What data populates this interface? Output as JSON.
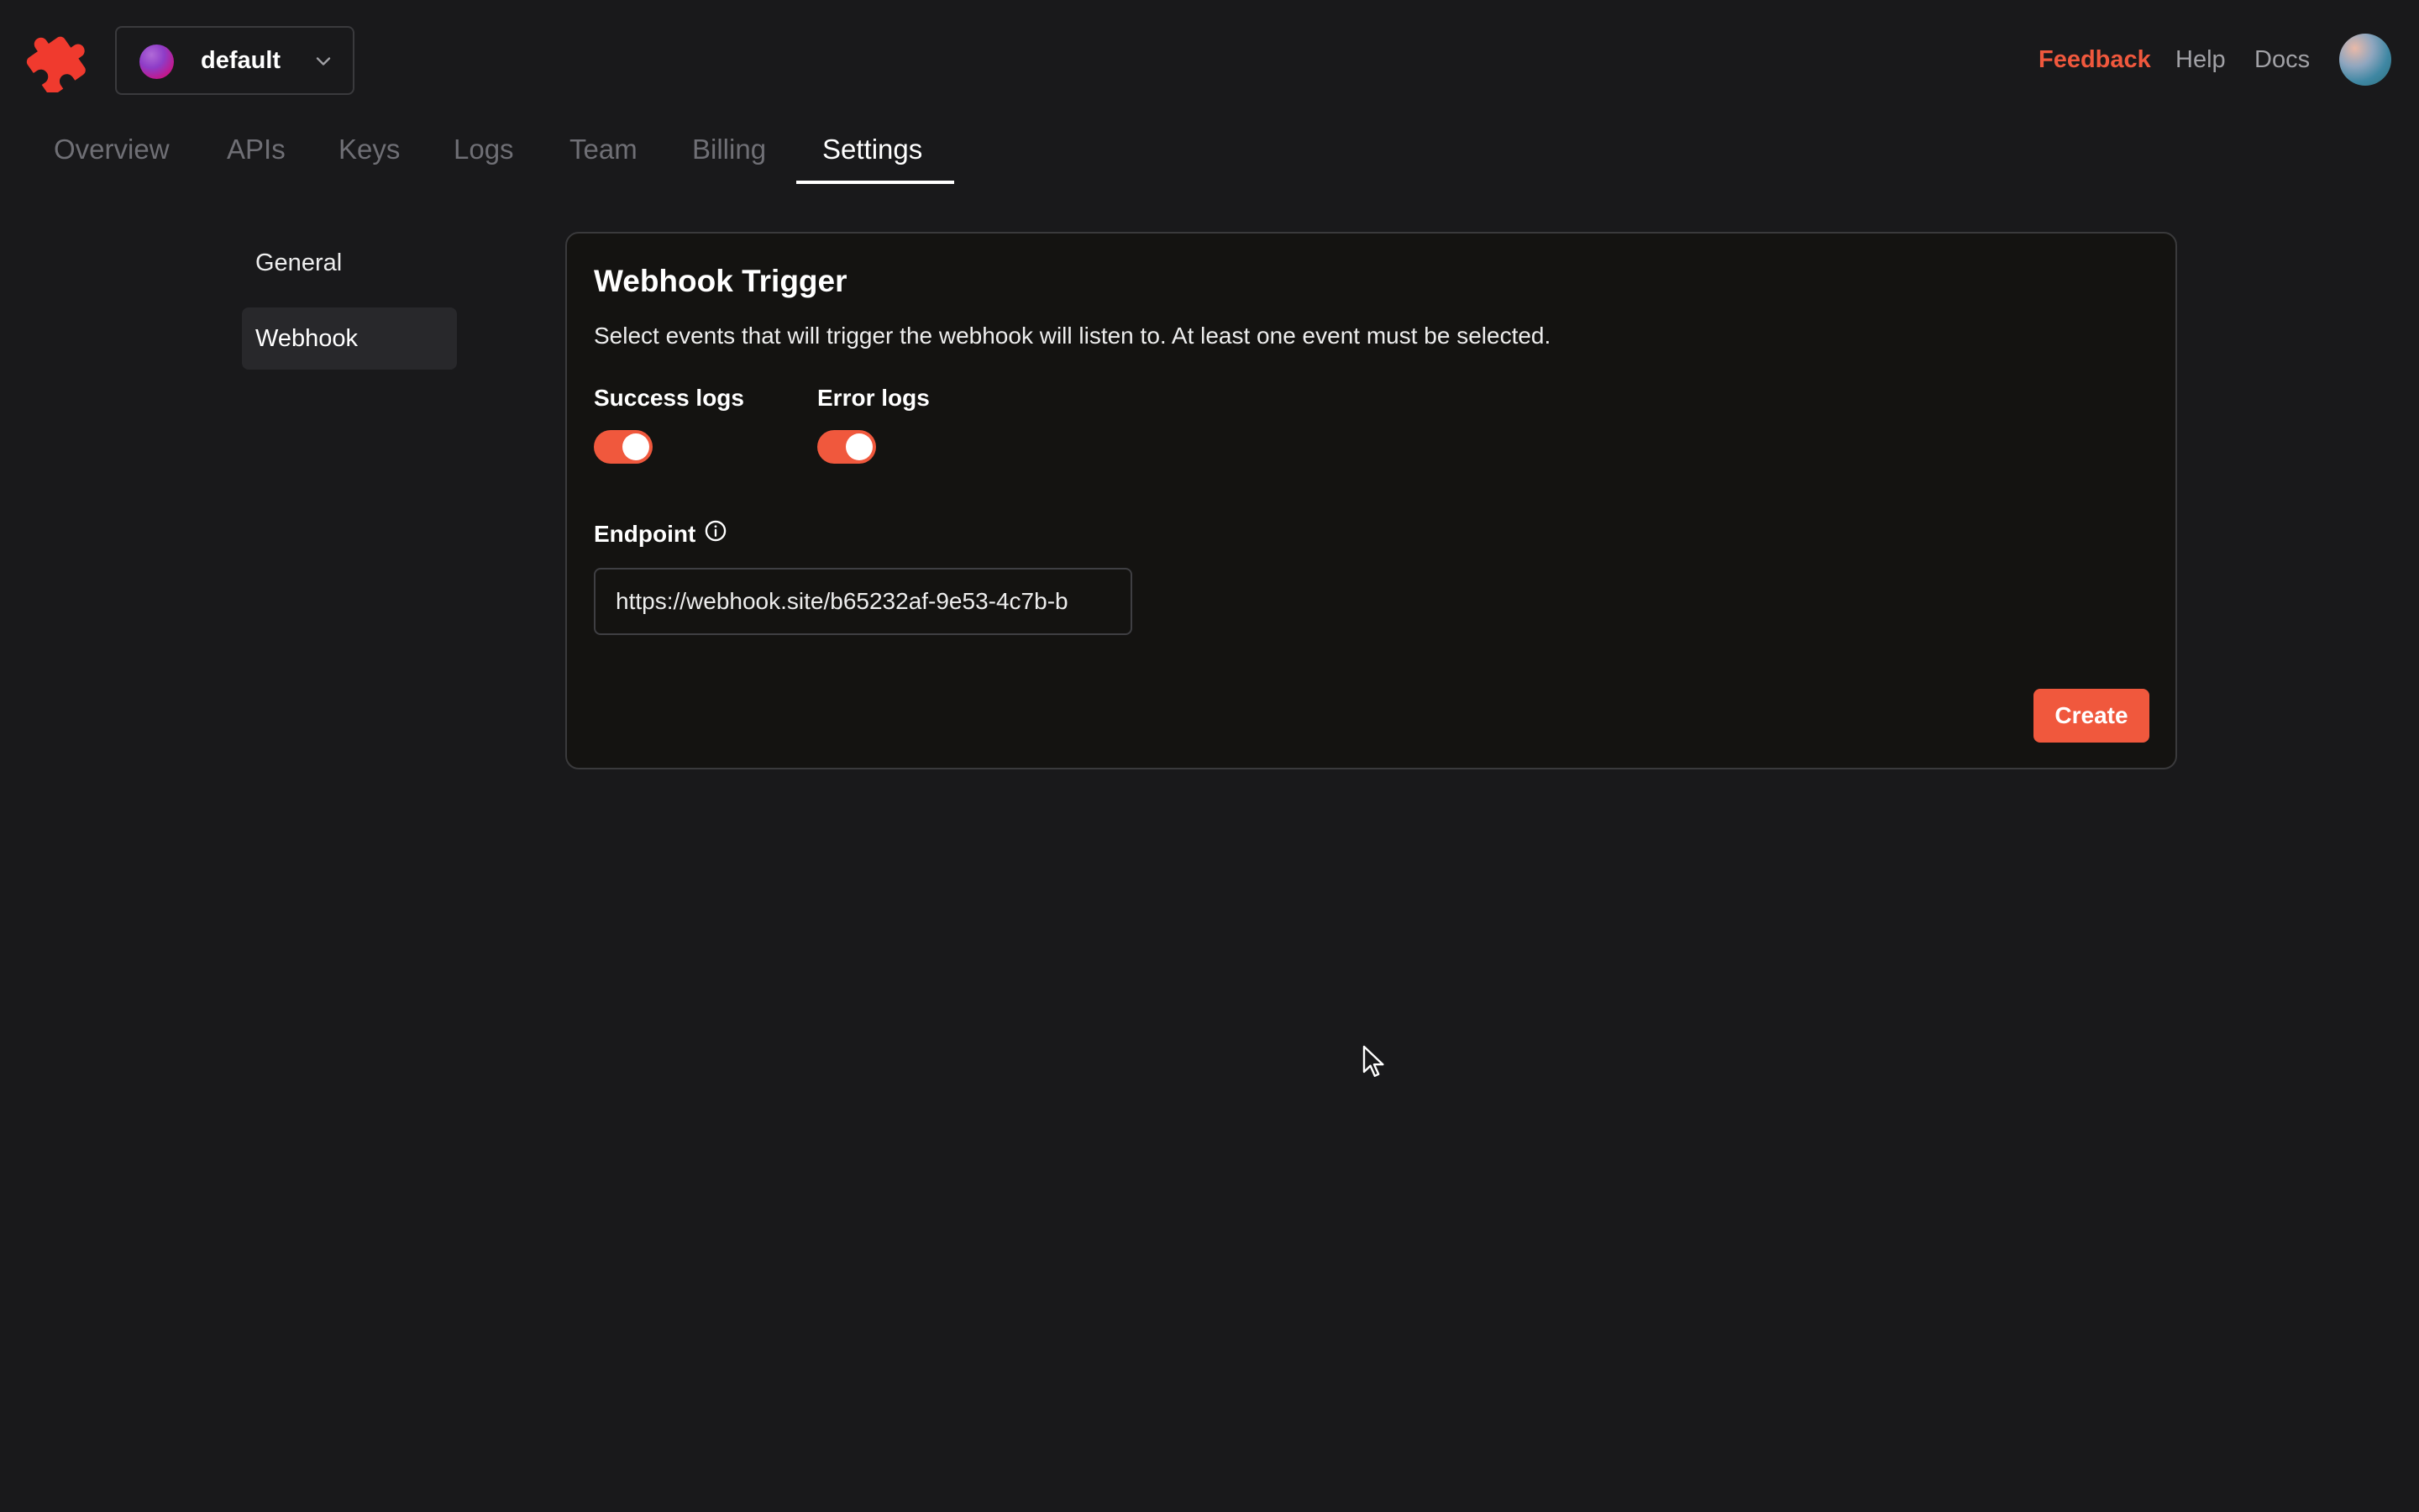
{
  "header": {
    "team_name": "default",
    "links": {
      "feedback": "Feedback",
      "help": "Help",
      "docs": "Docs"
    },
    "accent_color": "#f0583d"
  },
  "nav": {
    "tabs": [
      {
        "label": "Overview",
        "active": false
      },
      {
        "label": "APIs",
        "active": false
      },
      {
        "label": "Keys",
        "active": false
      },
      {
        "label": "Logs",
        "active": false
      },
      {
        "label": "Team",
        "active": false
      },
      {
        "label": "Billing",
        "active": false
      },
      {
        "label": "Settings",
        "active": true
      }
    ]
  },
  "settings_nav": {
    "items": [
      {
        "label": "General",
        "active": false
      },
      {
        "label": "Webhook",
        "active": true
      }
    ]
  },
  "webhook": {
    "title": "Webhook Trigger",
    "description": "Select events that will trigger the webhook will listen to. At least one event must be selected.",
    "success_logs": {
      "label": "Success logs",
      "enabled": true
    },
    "error_logs": {
      "label": "Error logs",
      "enabled": true
    },
    "endpoint_label": "Endpoint",
    "endpoint_value": "https://webhook.site/b65232af-9e53-4c7b-b",
    "create_label": "Create"
  },
  "icons": {
    "logo": "puzzle-piece-logo-icon",
    "chevron": "chevron-down-icon",
    "info": "info-circle-icon",
    "cursor": "mouse-pointer-icon"
  }
}
